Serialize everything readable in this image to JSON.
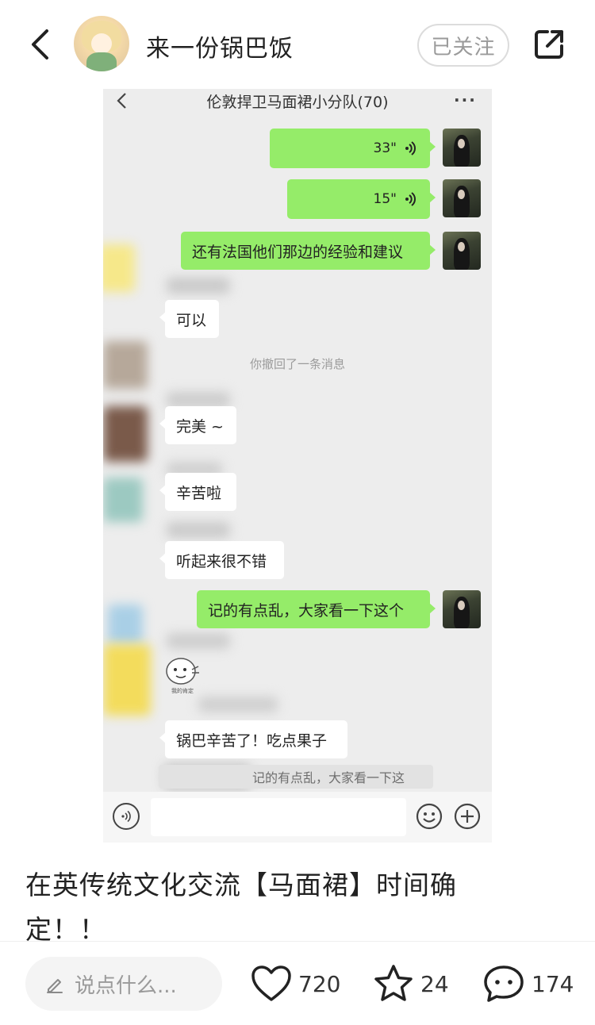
{
  "header": {
    "username": "来一份锅巴饭",
    "follow_label": "已关注"
  },
  "chat": {
    "title": "伦敦捍卫马面裙小分队(70)",
    "more": "···",
    "voice1": "33\"",
    "voice2": "15\"",
    "msg_france": "还有法国他们那边的经验和建议",
    "msg_ok": "可以",
    "recall_notice": "你撤回了一条消息",
    "msg_perfect": "完美 ~",
    "msg_thanks": "辛苦啦",
    "msg_sounds_good": "听起来很不错",
    "msg_messy": "记的有点乱，大家看一下这个",
    "sticker_caption": "我的肯定",
    "msg_guoba": "锅巴辛苦了！吃点果子",
    "quote_text": "记的有点乱，大家看一下这"
  },
  "post": {
    "title_line1": "在英传统文化交流【马面裙】时间确",
    "title_line2": "定！！"
  },
  "bottom": {
    "comment_placeholder": "说点什么...",
    "likes": "720",
    "favorites": "24",
    "comments": "174"
  },
  "colors": {
    "wechat_green": "#95ec69",
    "chat_bg": "#ededed"
  },
  "icons": [
    "back-icon",
    "share-icon",
    "voice-wave-icon",
    "emoji-icon",
    "plus-icon",
    "pencil-icon",
    "heart-icon",
    "star-icon",
    "comment-bubble-icon"
  ]
}
